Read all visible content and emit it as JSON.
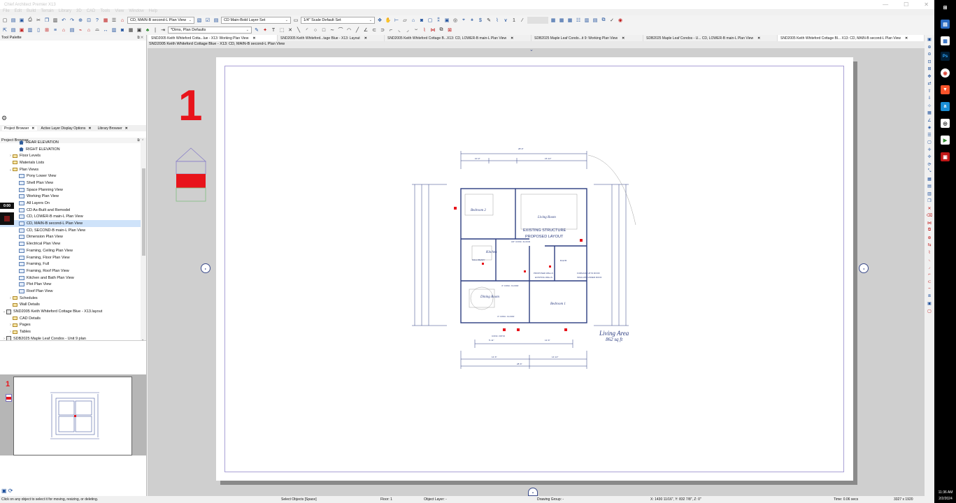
{
  "app": {
    "title": "Chief Architect Premier X13",
    "window_controls": [
      "—",
      "☐",
      "✕"
    ]
  },
  "menu": [
    "File",
    "Edit",
    "Build",
    "Terrain",
    "Library",
    "3D",
    "CAD",
    "Tools",
    "View",
    "Window",
    "Help"
  ],
  "toolbar": {
    "view_combo": "CD, MAIN-B second-L Plan View",
    "layer_set_combo": "CD Main-Bold Layer Set",
    "scale_combo": "1/4\" Scale Default Set",
    "dims_combo": "*Dims, Plan Defaults",
    "frame_counter": "1"
  },
  "tabs": [
    {
      "label": "SND2005 Keith Whiteford Cotta...lue - X13:  Working Plan View"
    },
    {
      "label": "SND2005 Keith Whiteford...tage Blue - X13: Layout"
    },
    {
      "label": "SND2005 Keith Whiteford Cottage B...X13: CD, LOWER-B main-L Plan View"
    },
    {
      "label": "SDB2025 Maple Leaf Condo...it 9:  Working Plan View"
    },
    {
      "label": "SDB2025 Maple Leaf Condos - U... CD, LOWER-B main-L Plan View"
    },
    {
      "label": "SND2005 Keith Whiteford Cottage Bl... X13: CD, MAIN-B second-L Plan View"
    }
  ],
  "panels": {
    "tool_palette": "Tool Palette",
    "project_browser": "Project Browser",
    "panel_tabs": [
      "Project Browser",
      "Active Layer Display Options",
      "Library Browser"
    ]
  },
  "tree": [
    {
      "label": "REAR ELEVATION",
      "depth": 3,
      "icon": "house-icon"
    },
    {
      "label": "RIGHT ELEVATION",
      "depth": 3,
      "icon": "house-icon"
    },
    {
      "label": "Floor Levels",
      "depth": 2,
      "icon": "folder-icon",
      "exp": "›"
    },
    {
      "label": "Materials Lists",
      "depth": 2,
      "icon": "folder-icon"
    },
    {
      "label": "Plan Views",
      "depth": 2,
      "icon": "folder-icon",
      "exp": "⌄"
    },
    {
      "label": "Pony Lower View",
      "depth": 3,
      "icon": "plan-view-icon"
    },
    {
      "label": "Shell Plan View",
      "depth": 3,
      "icon": "plan-view-icon"
    },
    {
      "label": "Space Planning View",
      "depth": 3,
      "icon": "plan-view-icon"
    },
    {
      "label": "Working Plan View",
      "depth": 3,
      "icon": "plan-view-icon"
    },
    {
      "label": "All Layers On",
      "depth": 3,
      "icon": "plan-view-icon"
    },
    {
      "label": "CD As-Built and Remodel",
      "depth": 3,
      "icon": "plan-view-icon"
    },
    {
      "label": "CD, LOWER-B main-L Plan View",
      "depth": 3,
      "icon": "plan-view-icon"
    },
    {
      "label": "CD, MAIN-B second-L Plan View",
      "depth": 3,
      "icon": "plan-view-icon",
      "selected": true
    },
    {
      "label": "CD, SECOND-B main-L Plan View",
      "depth": 3,
      "icon": "plan-view-icon"
    },
    {
      "label": "Dimension Plan View",
      "depth": 3,
      "icon": "plan-view-icon"
    },
    {
      "label": "Electrical Plan View",
      "depth": 3,
      "icon": "plan-view-icon"
    },
    {
      "label": "Framing, Ceiling Plan View",
      "depth": 3,
      "icon": "plan-view-icon"
    },
    {
      "label": "Framing, Floor Plan View",
      "depth": 3,
      "icon": "plan-view-icon"
    },
    {
      "label": "Framing, Full",
      "depth": 3,
      "icon": "plan-view-icon"
    },
    {
      "label": "Framing, Roof Plan View",
      "depth": 3,
      "icon": "plan-view-icon"
    },
    {
      "label": "Kitchen and Bath Plan View",
      "depth": 3,
      "icon": "plan-view-icon"
    },
    {
      "label": "Plot Plan View",
      "depth": 3,
      "icon": "plan-view-icon"
    },
    {
      "label": "Roof Plan View",
      "depth": 3,
      "icon": "plan-view-icon"
    },
    {
      "label": "Schedules",
      "depth": 2,
      "icon": "folder-icon",
      "exp": "›"
    },
    {
      "label": "Wall Details",
      "depth": 2,
      "icon": "folder-icon"
    },
    {
      "label": "SND2005 Keith Whiteford Cottage Blue - X13.layout",
      "depth": 1,
      "icon": "layout-icon",
      "exp": "⌄"
    },
    {
      "label": "CAD Details",
      "depth": 2,
      "icon": "folder-icon"
    },
    {
      "label": "Pages",
      "depth": 2,
      "icon": "folder-icon",
      "exp": "›"
    },
    {
      "label": "Tables",
      "depth": 2,
      "icon": "folder-icon",
      "exp": "›"
    },
    {
      "label": "SDB2025 Maple Leaf Condos - Unit 9 plan",
      "depth": 1,
      "icon": "plan-icon",
      "exp": "›"
    }
  ],
  "recorder": {
    "time": "0:00"
  },
  "view": {
    "title": "SND2005 Keith Whiteford Cottage Blue - X13: CD, MAIN-B second-L Plan View",
    "floor_number": "1",
    "thumb_floor": "1",
    "plan_note_1": "EXISTING STRUCTURE",
    "plan_note_2": "PROPOSED LAYOUT",
    "area_label_1": "Living Area",
    "area_label_2": "862 sq ft",
    "rooms": [
      "Bedroom 2",
      "Living Room",
      "Kitchen",
      "Dining Room",
      "Bedroom 1",
      "BATH"
    ],
    "dims": [
      "28'-6\"",
      "10'-0\"",
      "15'-10\"",
      "12'-6\"",
      "14'-10\"",
      "28'-6\"",
      "5'-11\"",
      "12'-6\""
    ],
    "floor_notes": [
      "3/4\" CONC. FLOOR",
      "4\" CONC. FLOOR",
      "CONC. PATIO",
      "4\" CONC. FLOOR"
    ],
    "plan_labels": [
      "PROPOSED WALLS",
      "EXISTING WALLS",
      "FURNACE UP IN ROOF",
      "INSULATE UNDER ROOF",
      "CALL READY"
    ]
  },
  "status": {
    "hint": "Click on any object to select it for moving, resizing, or deleting.",
    "mode": "Select Objects [Space]",
    "floor": "Floor: 1",
    "object_layer": "Object Layer: -",
    "drawing_group": "Drawing Group: -",
    "coords": "X: 1430 11/16\", Y: 832 7/8\", Z: 0\"",
    "time": "Time: 0.06 secs",
    "resolution": "3327 x 1920"
  },
  "taskbar": {
    "clock_time": "11:36 AM",
    "clock_date": "2/2/2024"
  },
  "colors": {
    "accent_red": "#e8141b",
    "plan_blue": "#2c3d80",
    "selection": "#cfe3fa"
  }
}
